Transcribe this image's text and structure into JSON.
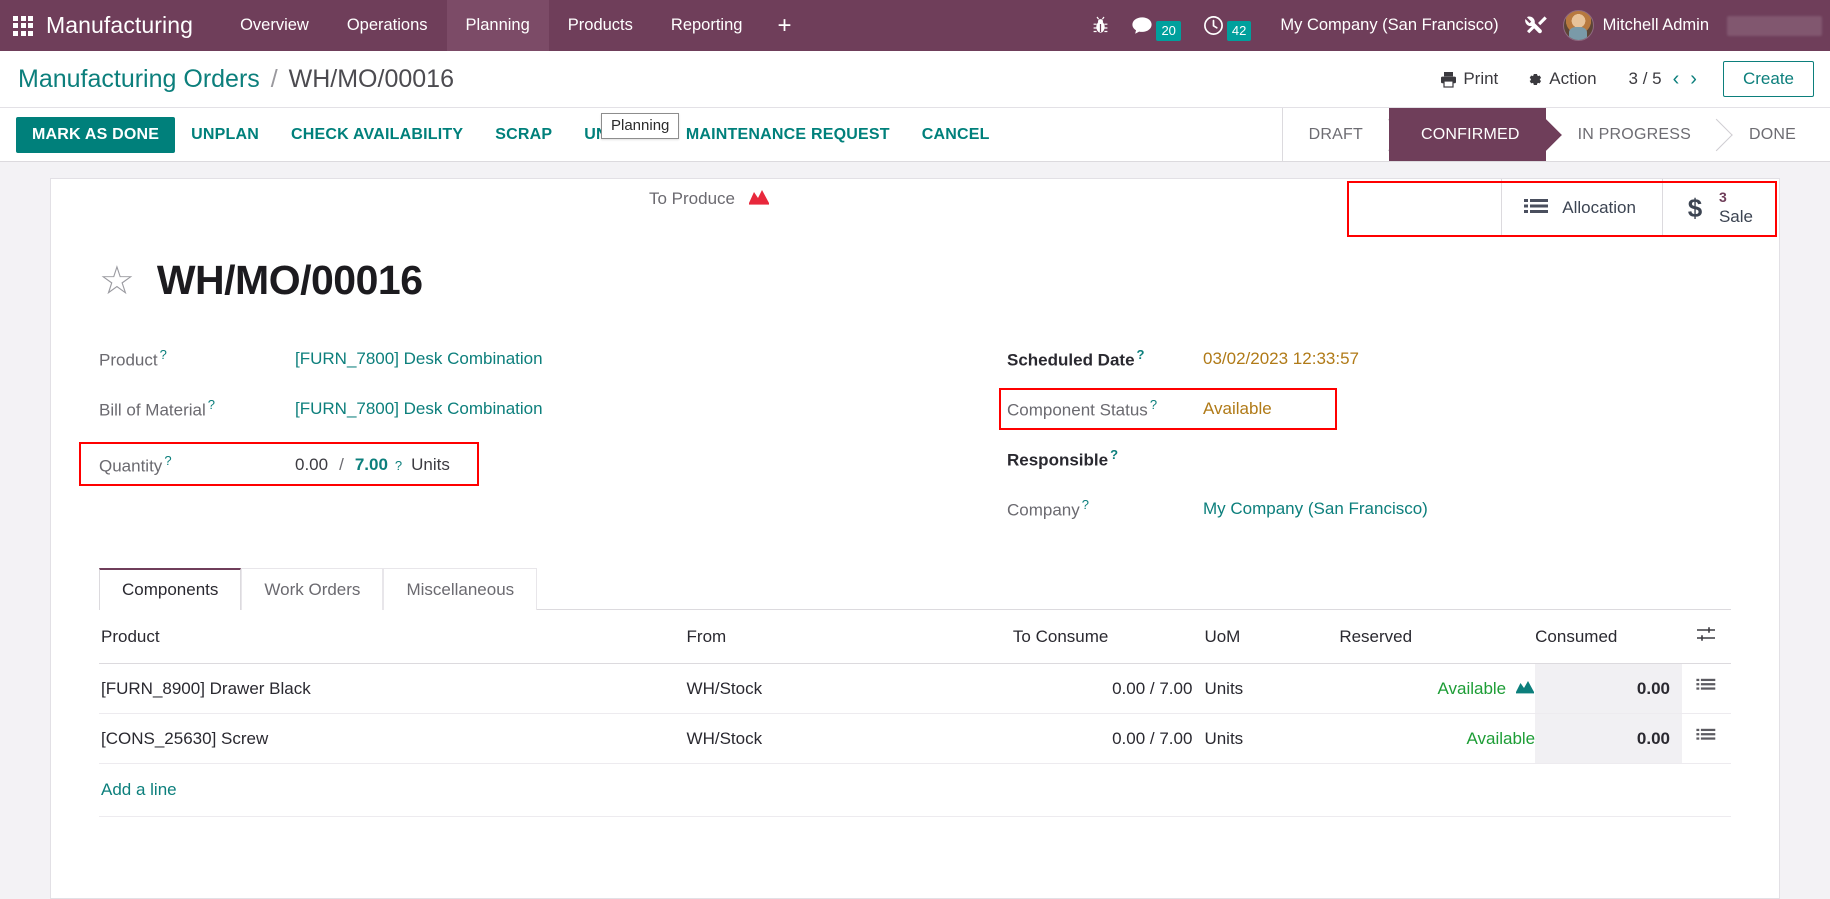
{
  "navbar": {
    "apps_icon": "grid-apps-icon",
    "brand": "Manufacturing",
    "menu": [
      {
        "label": "Overview",
        "active": false
      },
      {
        "label": "Operations",
        "active": false
      },
      {
        "label": "Planning",
        "active": true
      },
      {
        "label": "Products",
        "active": false
      },
      {
        "label": "Reporting",
        "active": false
      }
    ],
    "plus": "+",
    "debug_icon": "bug-icon",
    "messages": {
      "icon": "chat-bubble-icon",
      "count": "20"
    },
    "activities": {
      "icon": "clock-icon",
      "count": "42"
    },
    "company": "My Company (San Francisco)",
    "tools_icon": "wrench-screwdriver-icon",
    "user": "Mitchell Admin",
    "accent": "#6f3e5a"
  },
  "controlpanel": {
    "breadcrumb_root": "Manufacturing Orders",
    "breadcrumb_sep": "/",
    "breadcrumb_current": "WH/MO/00016",
    "tooltip": "Planning",
    "print": "Print",
    "action": "Action",
    "pager": "3 / 5",
    "prev": "‹",
    "next": "›",
    "create": "Create"
  },
  "statusbar": {
    "buttons": [
      {
        "label": "Mark as Done",
        "primary": true
      },
      {
        "label": "Unplan",
        "primary": false
      },
      {
        "label": "Check Availability",
        "primary": false
      },
      {
        "label": "Scrap",
        "primary": false
      },
      {
        "label": "Unlock",
        "primary": false
      },
      {
        "label": "Maintenance Request",
        "primary": false
      },
      {
        "label": "Cancel",
        "primary": false
      }
    ],
    "stages": [
      {
        "label": "Draft",
        "active": false
      },
      {
        "label": "Confirmed",
        "active": true
      },
      {
        "label": "In Progress",
        "active": false
      },
      {
        "label": "Done",
        "active": false
      }
    ],
    "active_color": "#6f3e5a"
  },
  "statbuttons": [
    {
      "icon": "list-bars-icon",
      "value": "",
      "label": "Allocation"
    },
    {
      "icon": "dollar-icon",
      "value": "3",
      "label": "Sale"
    }
  ],
  "record": {
    "star_icon": "star-outline-icon",
    "title": "WH/MO/00016",
    "left_fields": [
      {
        "label": "Product",
        "help": "?",
        "value": "[FURN_7800] Desk Combination",
        "style": "link"
      },
      {
        "label": "Bill of Material",
        "help": "?",
        "value": "[FURN_7800] Desk Combination",
        "style": "link"
      }
    ],
    "quantity": {
      "label": "Quantity",
      "help": "?",
      "done": "0.00",
      "separator": "/",
      "to_produce": "7.00",
      "qhelp": "?",
      "uom": "Units"
    },
    "to_produce_badge": {
      "label": "To Produce",
      "icon": "area-chart-icon",
      "color": "#e8283c"
    },
    "right_fields": [
      {
        "label": "Scheduled Date",
        "help": "?",
        "value": "03/02/2023 12:33:57",
        "style": "warn",
        "bold_label": true
      },
      {
        "label": "Component Status",
        "help": "?",
        "value": "Available",
        "style": "warn",
        "bold_label": false
      },
      {
        "label": "Responsible",
        "help": "?",
        "value": "",
        "style": "muted",
        "bold_label": true
      },
      {
        "label": "Company",
        "help": "?",
        "value": "My Company (San Francisco)",
        "style": "link",
        "bold_label": false
      }
    ]
  },
  "notebook": {
    "tabs": [
      {
        "label": "Components",
        "active": true
      },
      {
        "label": "Work Orders",
        "active": false
      },
      {
        "label": "Miscellaneous",
        "active": false
      }
    ],
    "table": {
      "columns": [
        "Product",
        "From",
        "To Consume",
        "UoM",
        "Reserved",
        "Consumed"
      ],
      "optional_icon": "column-settings-icon",
      "rows": [
        {
          "product": "[FURN_8900] Drawer Black",
          "from": "WH/Stock",
          "to_consume": "0.00 /  7.00",
          "uom": "Units",
          "reserved": "Available",
          "reserved_icon": "area-chart-icon",
          "consumed": "0.00",
          "row_icon": "list-bars-icon"
        },
        {
          "product": "[CONS_25630] Screw",
          "from": "WH/Stock",
          "to_consume": "0.00 /  7.00",
          "uom": "Units",
          "reserved": "Available",
          "reserved_icon": "",
          "consumed": "0.00",
          "row_icon": "list-bars-icon"
        }
      ],
      "add_line": "Add a line"
    }
  }
}
